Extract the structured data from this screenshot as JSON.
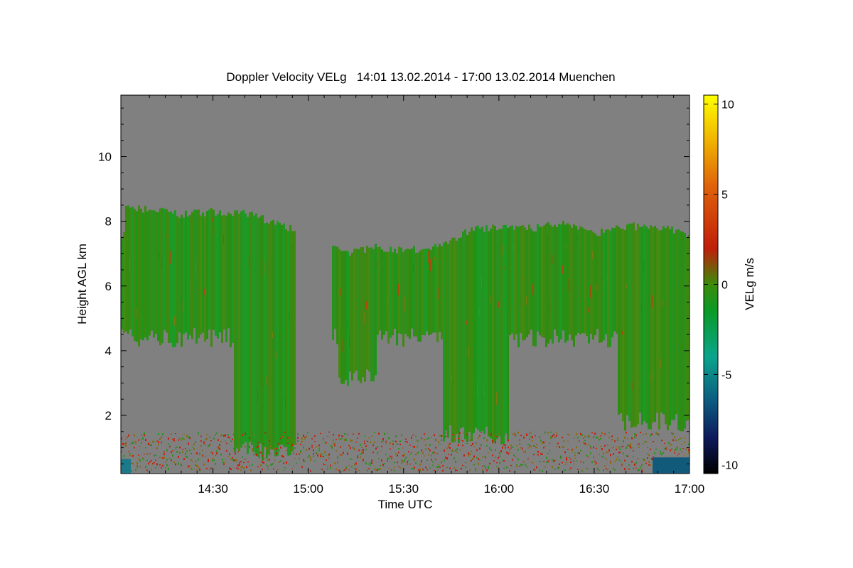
{
  "chart_data": {
    "type": "heatmap",
    "title": "Doppler Velocity VELg   14:01 13.02.2014 - 17:00 13.02.2014 Muenchen",
    "xlabel": "Time UTC",
    "ylabel": "Height AGL km",
    "x_start": "14:01",
    "x_end": "17:00",
    "xlim": [
      14.0167,
      17.0
    ],
    "ylim": [
      0.2,
      11.9
    ],
    "x_ticks": [
      "14:30",
      "15:00",
      "15:30",
      "16:00",
      "16:30",
      "17:00"
    ],
    "x_tick_values": [
      14.5,
      15.0,
      15.5,
      16.0,
      16.5,
      17.0
    ],
    "y_ticks": [
      "2",
      "4",
      "6",
      "8",
      "10"
    ],
    "y_tick_values": [
      2,
      4,
      6,
      8,
      10
    ],
    "background_color": "#808080",
    "cloud_top_km": [
      {
        "t": 14.03,
        "h": 8.45
      },
      {
        "t": 14.17,
        "h": 8.35
      },
      {
        "t": 14.33,
        "h": 8.2
      },
      {
        "t": 14.5,
        "h": 8.3
      },
      {
        "t": 14.67,
        "h": 8.25
      },
      {
        "t": 14.85,
        "h": 7.9
      },
      {
        "t": 15.0,
        "h": null
      },
      {
        "t": 15.2,
        "h": 7.0
      },
      {
        "t": 15.33,
        "h": 7.2
      },
      {
        "t": 15.5,
        "h": 7.1
      },
      {
        "t": 15.67,
        "h": 7.2
      },
      {
        "t": 15.83,
        "h": 7.7
      },
      {
        "t": 16.0,
        "h": 7.85
      },
      {
        "t": 16.17,
        "h": 7.8
      },
      {
        "t": 16.33,
        "h": 7.9
      },
      {
        "t": 16.5,
        "h": 7.6
      },
      {
        "t": 16.67,
        "h": 7.85
      },
      {
        "t": 16.83,
        "h": 7.8
      },
      {
        "t": 17.0,
        "h": 7.6
      }
    ],
    "colorbar": {
      "label": "VELg m/s",
      "range": [
        -10.5,
        10.5
      ],
      "ticks": [
        "10",
        "5",
        "0",
        "-5",
        "-10"
      ],
      "tick_values": [
        10,
        5,
        0,
        -5,
        -10
      ],
      "stops": [
        {
          "v": -10.5,
          "color": "#000000"
        },
        {
          "v": -8.5,
          "color": "#0d1a5c"
        },
        {
          "v": -6.5,
          "color": "#0d5a80"
        },
        {
          "v": -4.0,
          "color": "#0aa58c"
        },
        {
          "v": -1.5,
          "color": "#0a9a28"
        },
        {
          "v": 0.0,
          "color": "#3c8c0a"
        },
        {
          "v": 2.0,
          "color": "#c01e0a"
        },
        {
          "v": 5.5,
          "color": "#e0640a"
        },
        {
          "v": 8.0,
          "color": "#f0b400"
        },
        {
          "v": 10.5,
          "color": "#ffff00"
        }
      ]
    }
  }
}
